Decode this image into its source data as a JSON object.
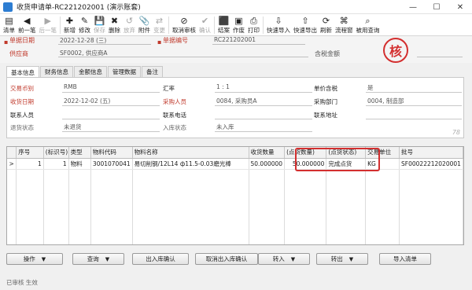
{
  "window": {
    "title": "收货申请单-RC221202001 (演示账套)",
    "controls": [
      "—",
      "☐",
      "✕"
    ]
  },
  "toolbar": {
    "buttons": [
      {
        "label": "清单",
        "icon": "list-icon",
        "glyph": "▤",
        "enabled": true
      },
      {
        "label": "前一笔",
        "icon": "arrow-left-icon",
        "glyph": "◀",
        "enabled": true
      },
      {
        "label": "后一笔",
        "icon": "arrow-right-icon",
        "glyph": "▶",
        "enabled": false
      },
      {
        "label": "新增",
        "icon": "new-icon",
        "glyph": "✚",
        "enabled": true
      },
      {
        "label": "修改",
        "icon": "edit-icon",
        "glyph": "✎",
        "enabled": true
      },
      {
        "label": "保存",
        "icon": "save-icon",
        "glyph": "💾",
        "enabled": false
      },
      {
        "label": "删除",
        "icon": "delete-icon",
        "glyph": "✖",
        "enabled": true
      },
      {
        "label": "放弃",
        "icon": "discard-icon",
        "glyph": "↺",
        "enabled": false
      },
      {
        "label": "附件",
        "icon": "attachment-icon",
        "glyph": "📎",
        "enabled": true
      },
      {
        "label": "变更",
        "icon": "change-icon",
        "glyph": "⇄",
        "enabled": false
      },
      {
        "label": "取消审核",
        "icon": "cancel-audit-icon",
        "glyph": "⊘",
        "enabled": true
      },
      {
        "label": "确认",
        "icon": "confirm-icon",
        "glyph": "✔",
        "enabled": false
      },
      {
        "label": "结案",
        "icon": "close-case-icon",
        "glyph": "⬛",
        "enabled": true
      },
      {
        "label": "作废",
        "icon": "void-icon",
        "glyph": "▣",
        "enabled": true
      },
      {
        "label": "打印",
        "icon": "print-icon",
        "glyph": "⎙",
        "enabled": true
      },
      {
        "label": "快速导入",
        "icon": "quick-import-icon",
        "glyph": "⇩",
        "enabled": true
      },
      {
        "label": "快速导出",
        "icon": "quick-export-icon",
        "glyph": "⇧",
        "enabled": true
      },
      {
        "label": "刷新",
        "icon": "refresh-icon",
        "glyph": "⟳",
        "enabled": true
      },
      {
        "label": "流程窗",
        "icon": "flow-window-icon",
        "glyph": "⌘",
        "enabled": true
      },
      {
        "label": "被用查询",
        "icon": "usage-query-icon",
        "glyph": "⌕",
        "enabled": true
      }
    ]
  },
  "header": {
    "doc_date_label": "单据日期",
    "doc_date_value": "2022-12-28 (三)",
    "doc_no_label": "单据编号",
    "doc_no_value": "RC221202001",
    "supplier_label": "供应商",
    "supplier_value": "SF0002, 供应商A",
    "amount_label": "含税金额",
    "seal_text": "核"
  },
  "tabs": [
    {
      "label": "基本信息",
      "active": true
    },
    {
      "label": "财务信息",
      "active": false
    },
    {
      "label": "金额信息",
      "active": false
    },
    {
      "label": "管理数据",
      "active": false
    },
    {
      "label": "备注",
      "active": false
    }
  ],
  "form": {
    "currency_label": "交易币别",
    "currency_value": "RMB",
    "rate_label": "汇率",
    "rate_value": "1 : 1",
    "tax_label": "单价含税",
    "tax_value": "是",
    "receive_date_label": "收货日期",
    "receive_date_value": "2022-12-02 (五)",
    "buyer_label": "采购人员",
    "buyer_value": "0084, 采购员A",
    "dept_label": "采购部门",
    "dept_value": "0004, 制造部",
    "contact_label": "联系人员",
    "phone_label": "联系电话",
    "address_label": "联系地址",
    "return_label": "退货状态",
    "return_value": "未退货",
    "stock_label": "入库状态",
    "stock_value": "未入库",
    "corner_number": "78"
  },
  "grid": {
    "columns": [
      "序号",
      "(标识号)",
      "类型",
      "物料代码",
      "物料名称",
      "收货数量",
      "(点货数量)",
      "(点货状态)",
      "交易单位",
      "批号"
    ],
    "rows": [
      {
        "marker": ">",
        "seq": "1",
        "tag": "1",
        "type": "物料",
        "code": "3001070041",
        "name": "易切削钢/12L14 ф11.5-0.03磨光棒",
        "qty": "50.000000",
        "count_qty": "50.000000",
        "count_status": "完成点货",
        "unit": "KG",
        "batch": "SF00022212020001"
      }
    ]
  },
  "bottom_buttons": {
    "operate": "操作",
    "query": "查询",
    "stock_confirm": "出入库确认",
    "cancel_stock_confirm": "取消出入库确认",
    "transfer_in": "转入",
    "transfer_out": "转出",
    "import_list": "导入清单"
  },
  "statusbar": {
    "text": "已审核 生效"
  },
  "colors": {
    "required_label": "#c0392b",
    "highlight": "#d32f2f"
  }
}
